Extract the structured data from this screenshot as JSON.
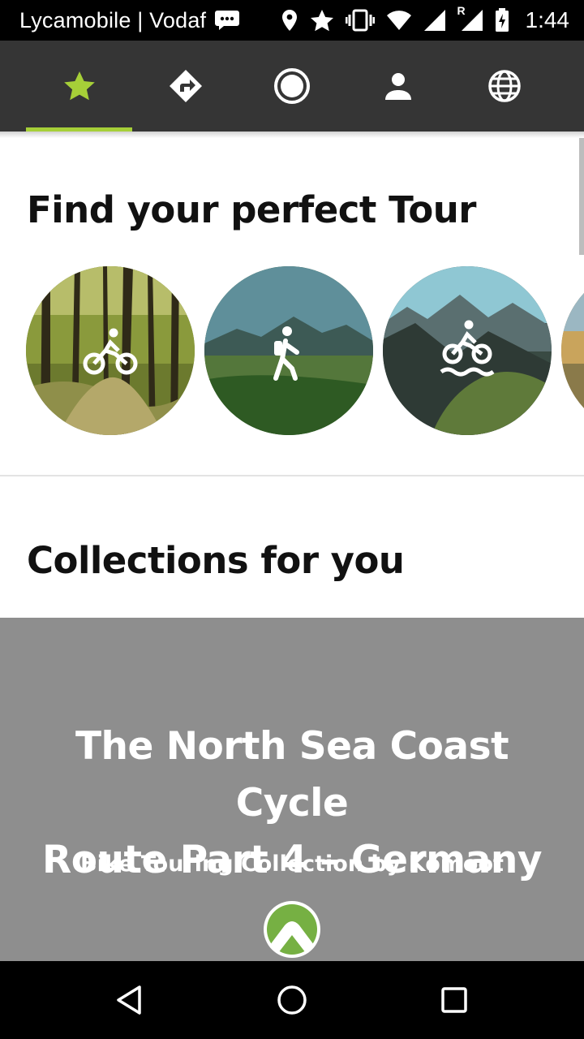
{
  "status_bar": {
    "carrier": "Lycamobile | Vodaf",
    "roaming_label": "R",
    "time": "1:44",
    "icons": [
      "message-icon",
      "location-icon",
      "star-icon",
      "vibrate-icon",
      "wifi-icon",
      "signal-icon",
      "roaming-signal-icon",
      "battery-charging-icon"
    ]
  },
  "top_nav": {
    "tabs": [
      {
        "name": "discover",
        "icon": "star-icon",
        "active": true
      },
      {
        "name": "plan",
        "icon": "route-sign-icon",
        "active": false
      },
      {
        "name": "record",
        "icon": "record-icon",
        "active": false
      },
      {
        "name": "profile",
        "icon": "person-icon",
        "active": false
      },
      {
        "name": "explore",
        "icon": "globe-icon",
        "active": false
      }
    ],
    "active_color": "#a6cf38"
  },
  "find_tour": {
    "title": "Find your perfect Tour",
    "sports": [
      {
        "icon": "road-bike-icon",
        "scene": "forest"
      },
      {
        "icon": "hiking-icon",
        "scene": "meadow-mountains"
      },
      {
        "icon": "mountain-bike-icon",
        "scene": "rocky-mountains"
      },
      {
        "icon": "sport-icon",
        "scene": "road"
      }
    ]
  },
  "collections": {
    "title": "Collections for you",
    "card": {
      "title_line1": "The North Sea Coast Cycle",
      "title_line2": "Route Part 4 – Germany",
      "subtitle": "Bike Touring Collection by Komoot",
      "logo_icon": "komoot-logo-icon"
    }
  },
  "android_nav": {
    "buttons": [
      "back-icon",
      "home-icon",
      "recents-icon"
    ]
  },
  "colors": {
    "nav_bg": "#353535",
    "accent": "#a6cf38",
    "card_bg": "#8e8e8e"
  }
}
